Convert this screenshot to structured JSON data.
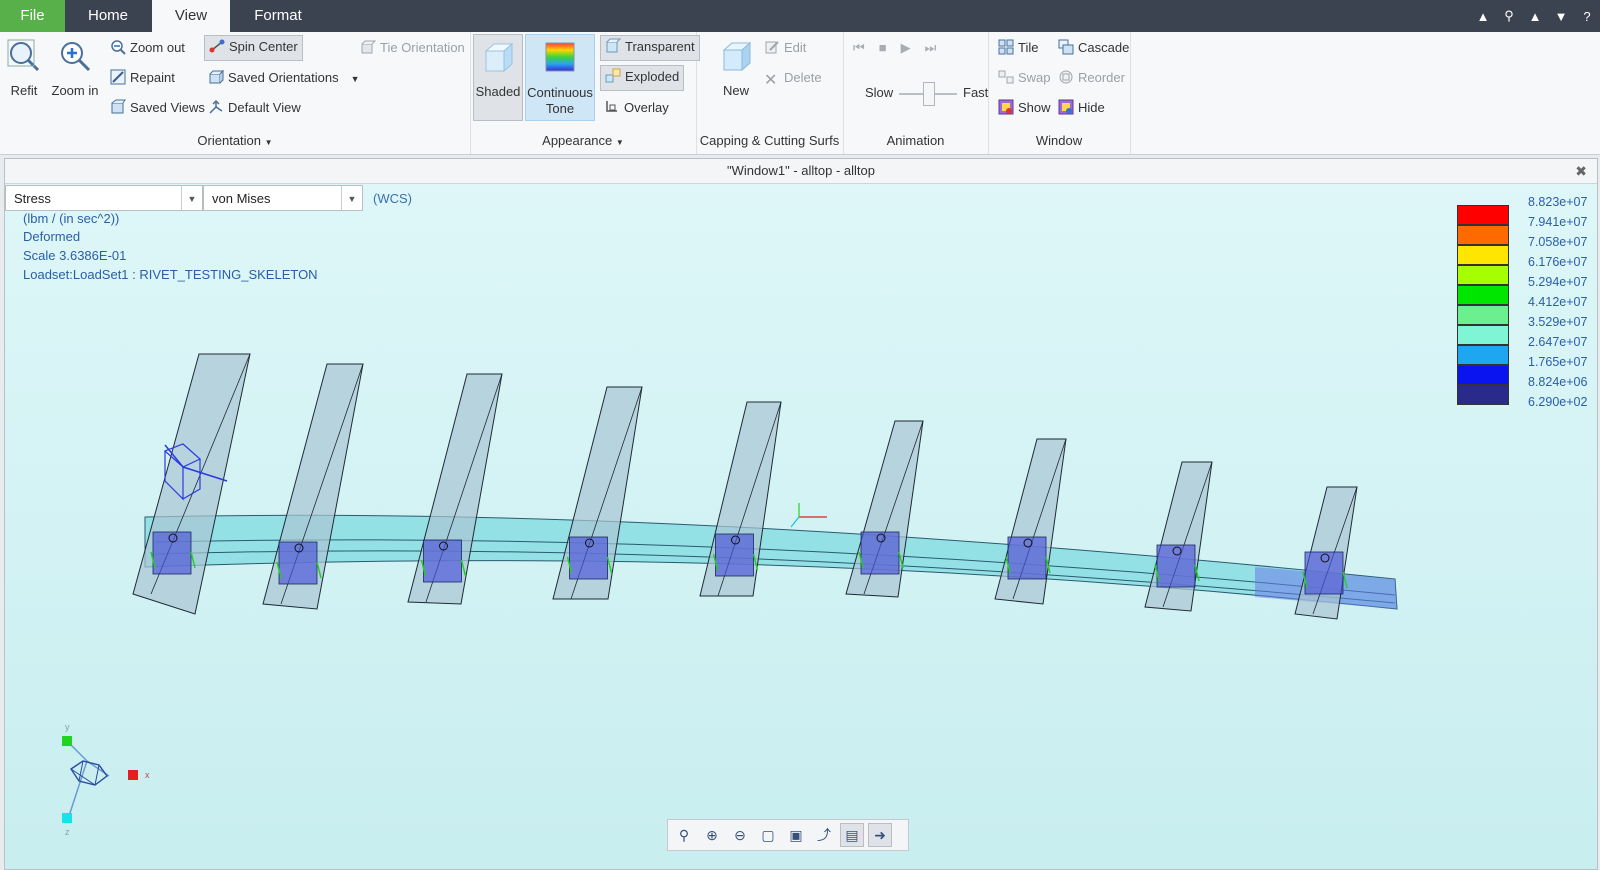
{
  "tabs": [
    {
      "label": "File"
    },
    {
      "label": "Home"
    },
    {
      "label": "View"
    },
    {
      "label": "Format"
    }
  ],
  "ribbon": {
    "orientation": {
      "refit": "Refit",
      "zoom_in": "Zoom in",
      "zoom_out": "Zoom out",
      "repaint": "Repaint",
      "saved_views": "Saved Views",
      "spin_center": "Spin Center",
      "saved_orientations": "Saved Orientations",
      "default_view": "Default View",
      "tie_orientation": "Tie Orientation",
      "label": "Orientation"
    },
    "appearance": {
      "shaded": "Shaded",
      "continuous_tone_1": "Continuous",
      "continuous_tone_2": "Tone",
      "transparent": "Transparent",
      "exploded": "Exploded",
      "overlay": "Overlay",
      "label": "Appearance"
    },
    "capping": {
      "new": "New",
      "edit": "Edit",
      "delete": "Delete",
      "label": "Capping & Cutting Surfs"
    },
    "animation": {
      "slow": "Slow",
      "fast": "Fast",
      "label": "Animation"
    },
    "window": {
      "tile": "Tile",
      "cascade": "Cascade",
      "swap": "Swap",
      "reorder": "Reorder",
      "show": "Show",
      "hide": "Hide",
      "label": "Window"
    }
  },
  "viewport": {
    "title": "\"Window1\" - alltop - alltop",
    "result_type": "Stress",
    "component": "von Mises",
    "wcs": "(WCS)",
    "info": {
      "units": "(lbm / (in sec^2))",
      "deformed": "Deformed",
      "scale": "Scale  3.6386E-01",
      "loadset": "Loadset:LoadSet1 :  RIVET_TESTING_SKELETON"
    },
    "legend": {
      "colors": [
        "#ff0000",
        "#ff6a00",
        "#ffe600",
        "#a6ff00",
        "#00e600",
        "#6cf08f",
        "#7ff5d6",
        "#1ea6f0",
        "#0a14f0",
        "#2a2a8a"
      ],
      "labels": [
        "8.823e+07",
        "7.941e+07",
        "7.058e+07",
        "6.176e+07",
        "5.294e+07",
        "4.412e+07",
        "3.529e+07",
        "2.647e+07",
        "1.765e+07",
        "8.824e+06",
        "6.290e+02"
      ]
    },
    "triad": {
      "x": "x",
      "y": "y",
      "z": "z"
    }
  }
}
